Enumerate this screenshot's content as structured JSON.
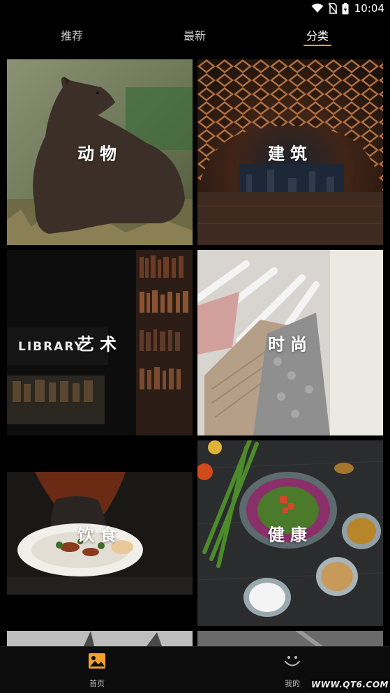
{
  "status_bar": {
    "time": "10:04",
    "icons": [
      "wifi-icon",
      "no-sim-icon",
      "battery-icon"
    ]
  },
  "tabs": [
    {
      "label": "推荐",
      "active": false
    },
    {
      "label": "最新",
      "active": false
    },
    {
      "label": "分类",
      "active": true
    }
  ],
  "accent_color": "#f2a12d",
  "categories": [
    {
      "label": "动物",
      "image": "bear photo"
    },
    {
      "label": "建筑",
      "image": "wooden arch pavilion with city skyline"
    },
    {
      "label": "艺术",
      "image": "dark library bookshelf with LIBRARY sign",
      "sign_text": "LIBRARY"
    },
    {
      "label": "时尚",
      "image": "knit sweaters on white hangers"
    },
    {
      "label": "饮食",
      "image": "plate of food held by person"
    },
    {
      "label": "健康",
      "image": "salad bowl with spices on dark table"
    }
  ],
  "bottom_nav": {
    "home": {
      "label": "首页",
      "icon": "image-icon"
    },
    "mine": {
      "label": "我的",
      "icon": "smiley-icon"
    }
  },
  "watermark": "WWW.QT6.COM"
}
